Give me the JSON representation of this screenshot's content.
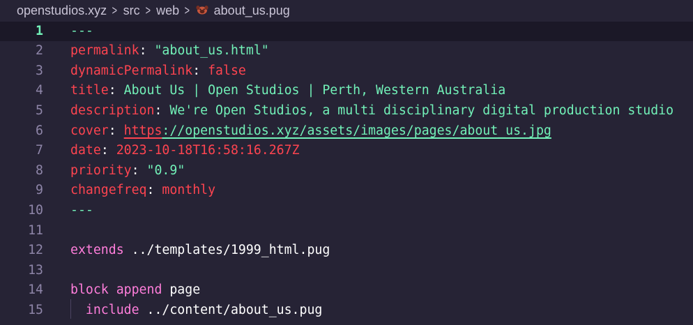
{
  "breadcrumb": {
    "segments": [
      "openstudios.xyz",
      "src",
      "web"
    ],
    "file": "about_us.pug",
    "separator": ">",
    "file_icon": "pug-dog-icon"
  },
  "editor": {
    "active_line": 1,
    "lines": [
      {
        "num": "1",
        "parts": [
          {
            "t": "---",
            "c": "green"
          }
        ]
      },
      {
        "num": "2",
        "parts": [
          {
            "t": "permalink",
            "c": "key"
          },
          {
            "t": ": ",
            "c": "plain"
          },
          {
            "t": "\"about_us.html\"",
            "c": "green"
          }
        ]
      },
      {
        "num": "3",
        "parts": [
          {
            "t": "dynamicPermalink",
            "c": "key"
          },
          {
            "t": ": ",
            "c": "plain"
          },
          {
            "t": "false",
            "c": "val"
          }
        ]
      },
      {
        "num": "4",
        "parts": [
          {
            "t": "title",
            "c": "key"
          },
          {
            "t": ": ",
            "c": "plain"
          },
          {
            "t": "About Us | Open Studios | Perth, Western Australia",
            "c": "green"
          }
        ]
      },
      {
        "num": "5",
        "parts": [
          {
            "t": "description",
            "c": "key"
          },
          {
            "t": ": ",
            "c": "plain"
          },
          {
            "t": "We're Open Studios, a multi disciplinary digital production studio",
            "c": "green"
          }
        ]
      },
      {
        "num": "6",
        "parts": [
          {
            "t": "cover",
            "c": "key"
          },
          {
            "t": ": ",
            "c": "plain"
          },
          {
            "t": "https",
            "c": "key",
            "u": true
          },
          {
            "t": "://openstudios.xyz/assets/images/pages/about_us.jpg",
            "c": "green",
            "u": true
          }
        ]
      },
      {
        "num": "7",
        "parts": [
          {
            "t": "date",
            "c": "key"
          },
          {
            "t": ": ",
            "c": "plain"
          },
          {
            "t": "2023-10-18T16:58:16.267Z",
            "c": "val"
          }
        ]
      },
      {
        "num": "8",
        "parts": [
          {
            "t": "priority",
            "c": "key"
          },
          {
            "t": ": ",
            "c": "plain"
          },
          {
            "t": "\"0.9\"",
            "c": "green"
          }
        ]
      },
      {
        "num": "9",
        "parts": [
          {
            "t": "changefreq",
            "c": "key"
          },
          {
            "t": ": ",
            "c": "plain"
          },
          {
            "t": "monthly",
            "c": "val"
          }
        ]
      },
      {
        "num": "10",
        "parts": [
          {
            "t": "---",
            "c": "green"
          }
        ]
      },
      {
        "num": "11",
        "parts": []
      },
      {
        "num": "12",
        "parts": [
          {
            "t": "extends",
            "c": "pink"
          },
          {
            "t": " ../templates/1999_html.pug",
            "c": "plain"
          }
        ]
      },
      {
        "num": "13",
        "parts": []
      },
      {
        "num": "14",
        "parts": [
          {
            "t": "block",
            "c": "pink"
          },
          {
            "t": " ",
            "c": "plain"
          },
          {
            "t": "append",
            "c": "pink"
          },
          {
            "t": " page",
            "c": "plain"
          }
        ]
      },
      {
        "num": "15",
        "parts": [
          {
            "t": "  ",
            "c": "plain"
          },
          {
            "t": "include",
            "c": "pink"
          },
          {
            "t": " ../content/about_us.pug",
            "c": "plain"
          }
        ]
      }
    ]
  },
  "colors": {
    "background": "#262335",
    "active_line_bg": "#1b1827",
    "key": "#fe4450",
    "string": "#72f1b8",
    "keyword": "#ff7edb",
    "line_number": "#8e85a8",
    "line_number_active": "#72f1b8"
  }
}
